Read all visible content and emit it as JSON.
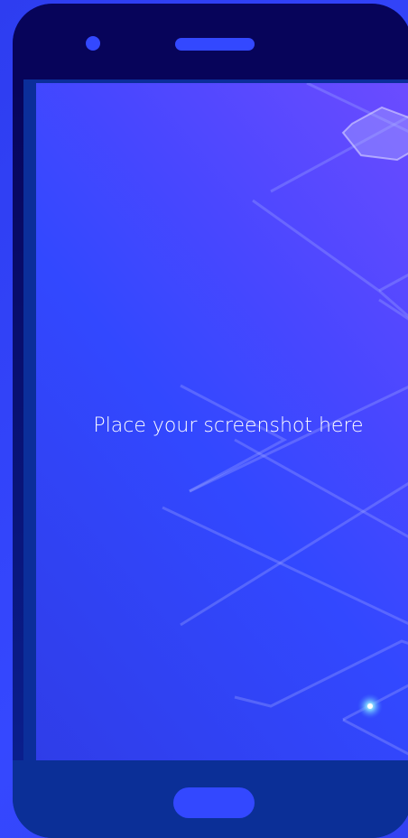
{
  "screen": {
    "placeholder_text": "Place your screenshot here"
  },
  "colors": {
    "background": "#2f3ff0",
    "top_bezel": "#07045a",
    "bottom_bezel": "#0b2f97",
    "accent": "#3348ff",
    "screen_highlight": "#6d4cff"
  },
  "icons": {
    "camera": "front-camera-icon",
    "speaker": "earpiece-speaker-icon",
    "home": "home-button-icon",
    "sparkle": "sparkle-icon"
  }
}
